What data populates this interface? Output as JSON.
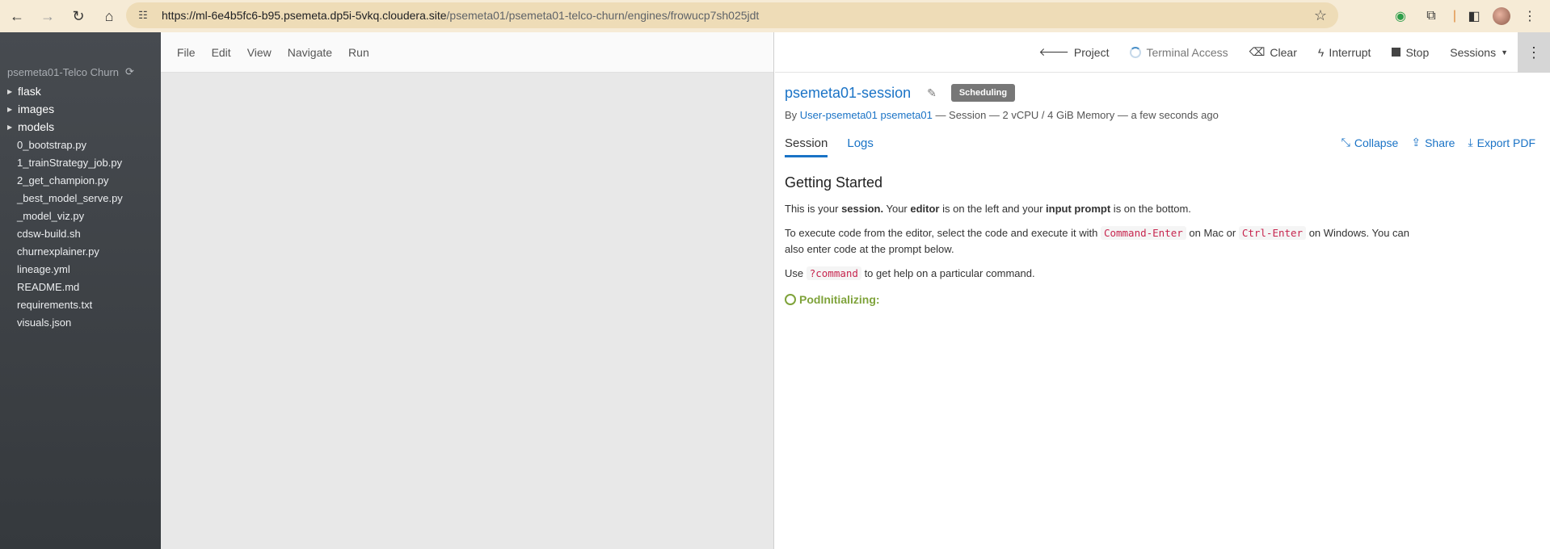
{
  "browser": {
    "url_host": "https://ml-6e4b5fc6-b95.psemeta.dp5i-5vkq.cloudera.site",
    "url_path": "/psemeta01/psemeta01-telco-churn/engines/frowucp7sh025jdt"
  },
  "sidebar": {
    "project_name": "psemeta01-Telco Churn",
    "folders": [
      "flask",
      "images",
      "models"
    ],
    "files": [
      "0_bootstrap.py",
      "1_trainStrategy_job.py",
      "2_get_champion.py",
      "_best_model_serve.py",
      "_model_viz.py",
      "cdsw-build.sh",
      "churnexplainer.py",
      "lineage.yml",
      "README.md",
      "requirements.txt",
      "visuals.json"
    ]
  },
  "editor": {
    "menu": [
      "File",
      "Edit",
      "View",
      "Navigate",
      "Run"
    ]
  },
  "toolbar": {
    "project": "Project",
    "terminal": "Terminal Access",
    "clear": "Clear",
    "interrupt": "Interrupt",
    "stop": "Stop",
    "sessions": "Sessions"
  },
  "session": {
    "title": "psemeta01-session",
    "badge": "Scheduling",
    "by": "By",
    "user_link": "User-psemeta01 psemeta01",
    "meta_rest": " — Session — 2 vCPU / 4 GiB Memory — a few seconds ago",
    "tabs": [
      "Session",
      "Logs"
    ],
    "actions": [
      "Collapse",
      "Share",
      "Export PDF"
    ],
    "heading": "Getting Started",
    "p1": [
      "This is your ",
      "session.",
      " Your ",
      "editor",
      " is on the left and your ",
      "input prompt",
      " is on the bottom."
    ],
    "p2": [
      "To execute code from the editor, select the code and execute it with ",
      "Command-Enter",
      " on Mac or ",
      "Ctrl-Enter",
      " on Windows. You can",
      "also enter code at the prompt below."
    ],
    "p3": [
      "Use ",
      "?command",
      " to get help on a particular command."
    ],
    "status": "PodInitializing:"
  },
  "colors": {
    "accent": "#1a73c6",
    "status_green": "#7fa33b",
    "badge_gray": "#777777"
  }
}
